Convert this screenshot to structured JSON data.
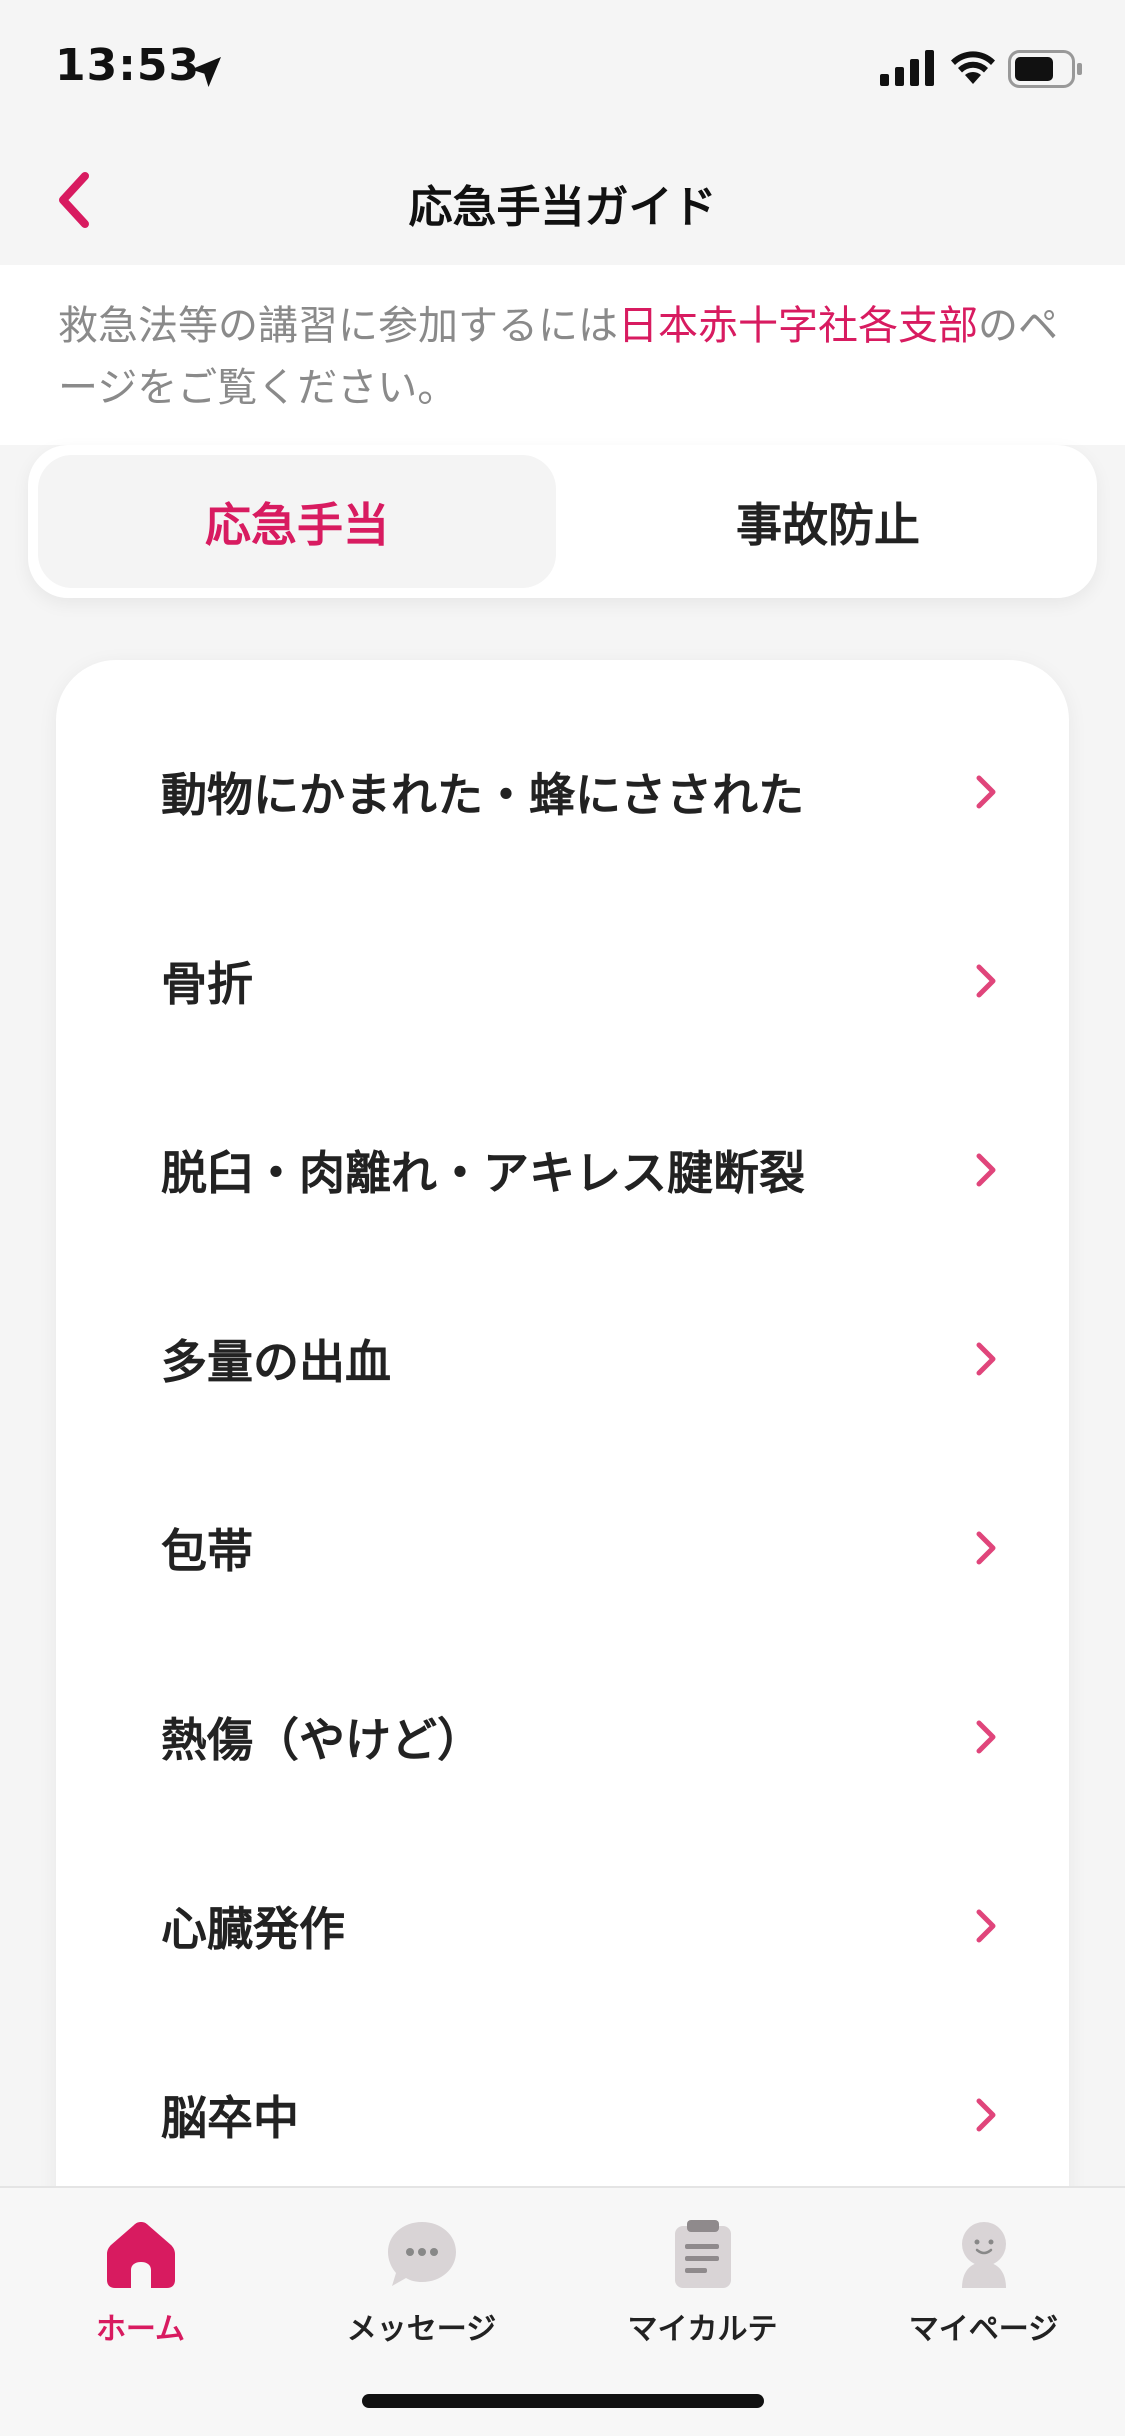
{
  "status_bar": {
    "time": "13:53"
  },
  "nav": {
    "title": "応急手当ガイド"
  },
  "info": {
    "text_before": "救急法等の講習に参加するには",
    "link_text": "日本赤十字社各支部",
    "text_after": "のページをご覧ください。"
  },
  "segment": {
    "tabs": [
      {
        "label": "応急手当",
        "active": true
      },
      {
        "label": "事故防止",
        "active": false
      }
    ]
  },
  "list": {
    "items": [
      {
        "label": "動物にかまれた・蜂にさされた"
      },
      {
        "label": "骨折"
      },
      {
        "label": "脱臼・肉離れ・アキレス腱断裂"
      },
      {
        "label": "多量の出血"
      },
      {
        "label": "包帯"
      },
      {
        "label": "熱傷（やけど）"
      },
      {
        "label": "心臓発作"
      },
      {
        "label": "脳卒中"
      }
    ]
  },
  "tab_bar": {
    "items": [
      {
        "label": "ホーム",
        "icon": "home-icon",
        "active": true
      },
      {
        "label": "メッセージ",
        "icon": "message-icon",
        "active": false
      },
      {
        "label": "マイカルテ",
        "icon": "clipboard-icon",
        "active": false
      },
      {
        "label": "マイページ",
        "icon": "person-icon",
        "active": false
      }
    ]
  },
  "colors": {
    "accent": "#d81b60",
    "inactive_icon": "#d9d4d6"
  }
}
